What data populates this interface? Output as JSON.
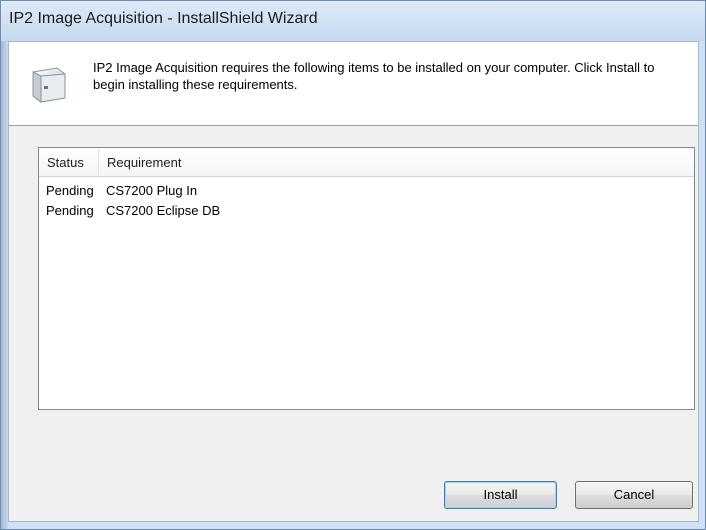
{
  "window": {
    "title": "IP2 Image Acquisition - InstallShield Wizard"
  },
  "header": {
    "icon": "computer-icon",
    "message": "IP2 Image Acquisition requires the following items to be installed on your computer. Click Install to begin installing these requirements."
  },
  "requirements_list": {
    "columns": [
      "Status",
      "Requirement"
    ],
    "rows": [
      {
        "status": "Pending",
        "requirement": "CS7200 Plug In"
      },
      {
        "status": "Pending",
        "requirement": "CS7200 Eclipse DB"
      }
    ]
  },
  "buttons": {
    "install_label": "Install",
    "cancel_label": "Cancel"
  }
}
